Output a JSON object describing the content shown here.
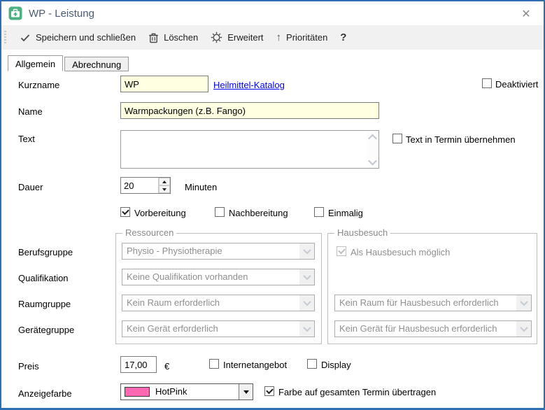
{
  "window": {
    "title": "WP - Leistung"
  },
  "icons": {
    "close": "✕",
    "priorities_arrow": "↑",
    "help": "?"
  },
  "toolbar": {
    "items": [
      {
        "label": "Speichern und schließen",
        "icon": "check-icon"
      },
      {
        "label": "Löschen",
        "icon": "trash-icon"
      },
      {
        "label": "Erweitert",
        "icon": "gear-icon"
      },
      {
        "label": "Prioritäten",
        "icon": "arrow-up-icon"
      },
      {
        "label": "?",
        "icon": "help-icon"
      }
    ]
  },
  "tabs": [
    {
      "label": "Allgemein",
      "active": true
    },
    {
      "label": "Abrechnung",
      "active": false
    }
  ],
  "form": {
    "kurzname_label": "Kurzname",
    "kurzname_value": "WP",
    "katalog_link": "Heilmittel-Katalog",
    "deaktiviert": {
      "label": "Deaktiviert",
      "checked": false
    },
    "name_label": "Name",
    "name_value": "Warmpackungen (z.B. Fango)",
    "text_label": "Text",
    "text_value": "",
    "text_uebernehmen": {
      "label": "Text in Termin übernehmen",
      "checked": false
    },
    "dauer_label": "Dauer",
    "dauer_value": "20",
    "dauer_unit": "Minuten",
    "vorbereitung": {
      "label": "Vorbereitung",
      "checked": true
    },
    "nachbereitung": {
      "label": "Nachbereitung",
      "checked": false
    },
    "einmalig": {
      "label": "Einmalig",
      "checked": false
    },
    "berufsgruppe_label": "Berufsgruppe",
    "qualifikation_label": "Qualifikation",
    "raumgruppe_label": "Raumgruppe",
    "geraetegruppe_label": "Gerätegruppe",
    "ressourcen": {
      "legend": "Ressourcen",
      "berufsgruppe_value": "Physio - Physiotherapie",
      "qualifikation_value": "Keine Qualifikation vorhanden",
      "raumgruppe_value": "Kein Raum erforderlich",
      "geraetegruppe_value": "Kein Gerät erforderlich"
    },
    "hausbesuch": {
      "legend": "Hausbesuch",
      "moeglich": {
        "label": "Als Hausbesuch möglich",
        "checked": true,
        "disabled": true
      },
      "raum_value": "Kein Raum für Hausbesuch erforderlich",
      "geraet_value": "Kein Gerät für Hausbesuch erforderlich"
    },
    "preis_label": "Preis",
    "preis_value": "17,00",
    "currency": "€",
    "internetangebot": {
      "label": "Internetangebot",
      "checked": false
    },
    "display": {
      "label": "Display",
      "checked": false
    },
    "anzeigefarbe_label": "Anzeigefarbe",
    "farbe": {
      "name": "HotPink",
      "hex": "#FF69B4"
    },
    "farbe_uebertragen": {
      "label": "Farbe auf gesamten Termin übertragen",
      "checked": true
    }
  },
  "colors": {
    "window_border": "#2E6FB4",
    "toolbar_bg": "#F1F1F1",
    "field_yellow": "#FFFFE1",
    "link_blue": "#0000EE",
    "hotpink": "#FF69B4",
    "icon_green": "#4CB180"
  }
}
